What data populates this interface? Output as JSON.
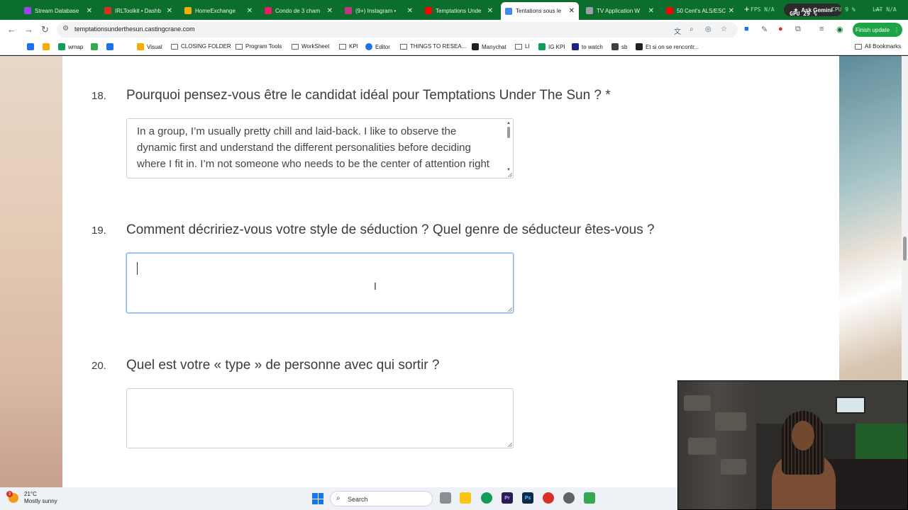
{
  "tabs": [
    {
      "title": "Stream Database",
      "color": "#a142f4",
      "active": false
    },
    {
      "title": "IRLToolkit • Dashb",
      "color": "#d93025",
      "active": false
    },
    {
      "title": "HomeExchange",
      "color": "#f9ab00",
      "active": false
    },
    {
      "title": "Condo de 3 cham",
      "color": "#e91e63",
      "active": false
    },
    {
      "title": "(9+) Instagram • ",
      "color": "#c13584",
      "active": false
    },
    {
      "title": "Temptations Unde",
      "color": "#ff0000",
      "active": false
    },
    {
      "title": "Tentations sous le",
      "color": "#4285f4",
      "active": true
    },
    {
      "title": "TV Application W",
      "color": "#9aa0a6",
      "active": false
    },
    {
      "title": "50 Cent's ALS/ESC",
      "color": "#ff0000",
      "active": false
    }
  ],
  "browser": {
    "ask_gemini": "Ask Gemini",
    "url": "temptationsunderthesun.castingcrane.com",
    "finish_update": "Finish update",
    "all_bookmarks": "All Bookmarks"
  },
  "stats_overlay": {
    "fps": "FPS  N/A",
    "gpu": "GPU  29 %",
    "cpu": "CPU  9 %",
    "lat": "LAT  N/A"
  },
  "bookmarks": [
    {
      "label": "",
      "color": "#1a73e8"
    },
    {
      "label": "",
      "color": "#f9ab00"
    },
    {
      "label": "wmap",
      "color": "#0f9d58"
    },
    {
      "label": "",
      "color": "#34a853"
    },
    {
      "label": "",
      "color": "#1a73e8"
    },
    {
      "label": "Visual",
      "color": "#f9ab00"
    },
    {
      "label": "CLOSING FOLDER",
      "folder": true
    },
    {
      "label": "Program Tools",
      "folder": true
    },
    {
      "label": "WorkSheet",
      "folder": true
    },
    {
      "label": "KPI",
      "folder": true
    },
    {
      "label": "Editor",
      "color": "#1a73e8"
    },
    {
      "label": "THINGS TO RESEA...",
      "folder": true
    },
    {
      "label": "Manychat",
      "color": "#202124"
    },
    {
      "label": "LI",
      "folder": true
    },
    {
      "label": "IG KPI",
      "color": "#0f9d58"
    },
    {
      "label": "to watch",
      "color": "#1a237e"
    },
    {
      "label": "sb",
      "color": "#3c4043"
    },
    {
      "label": "Et si on se rencontr...",
      "color": "#202124"
    }
  ],
  "questions": [
    {
      "number": "18.",
      "text": "Pourquoi pensez-vous être le candidat idéal pour Temptations Under The Sun ? *",
      "answer": "In a group, I’m usually pretty chill and laid-back. I like to observe the dynamic first and understand the different personalities before deciding where I fit in. I’m not someone who needs to be the center of attention right away."
    },
    {
      "number": "19.",
      "text": "Comment décririez-vous votre style de séduction ? Quel genre de séducteur êtes-vous ?",
      "answer": ""
    },
    {
      "number": "20.",
      "text": "Quel est votre « type » de personne avec qui sortir ?",
      "answer": ""
    }
  ],
  "taskbar": {
    "weather_badge": "3",
    "temperature": "21°C",
    "condition": "Mostly sunny",
    "search_label": "Search"
  },
  "icons": {
    "back": "back-arrow-icon",
    "forward": "forward-arrow-icon",
    "reload": "reload-icon",
    "star": "bookmark-star-icon",
    "cursor": "text-cursor-icon"
  }
}
